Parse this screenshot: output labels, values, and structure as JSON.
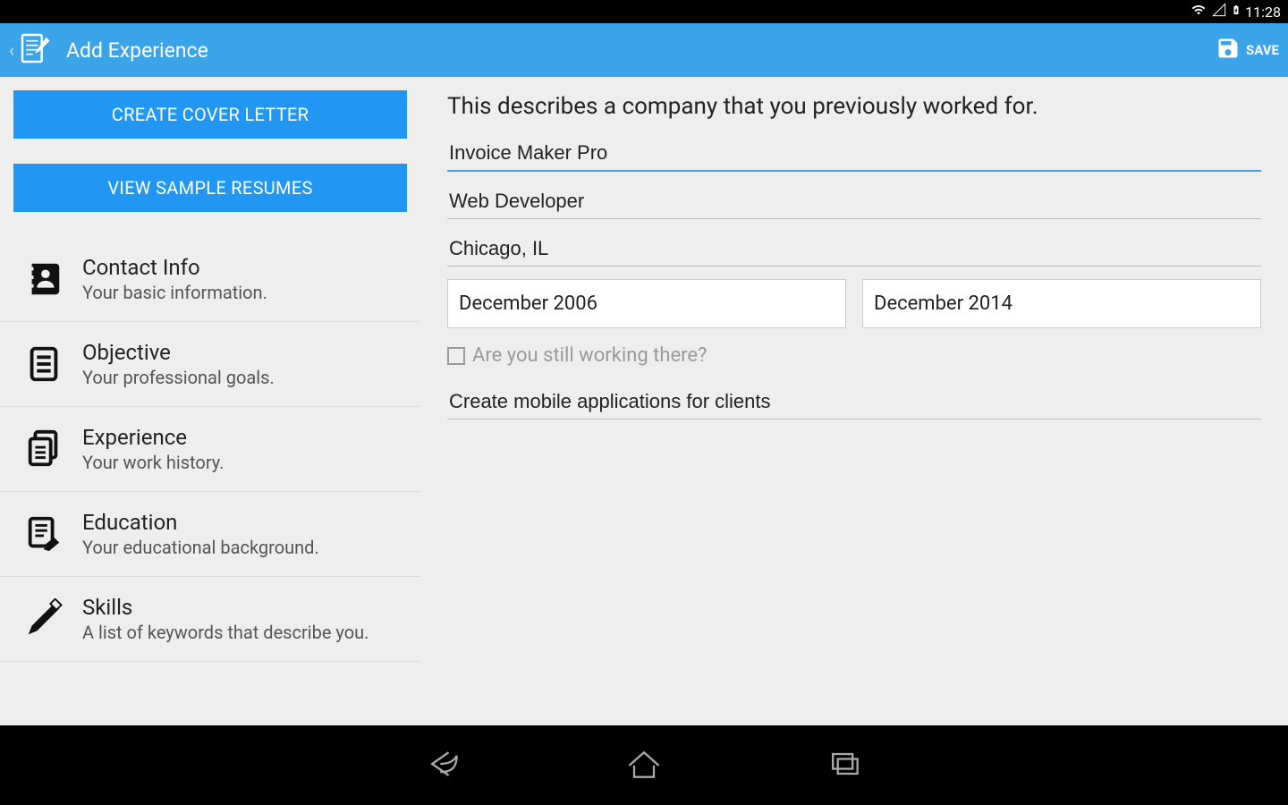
{
  "status": {
    "time": "11:28"
  },
  "actionbar": {
    "title": "Add Experience",
    "save": "SAVE"
  },
  "sidebar": {
    "btn_cover": "CREATE COVER LETTER",
    "btn_samples": "VIEW SAMPLE RESUMES",
    "items": [
      {
        "title": "Contact Info",
        "subtitle": "Your basic information."
      },
      {
        "title": "Objective",
        "subtitle": "Your professional goals."
      },
      {
        "title": "Experience",
        "subtitle": "Your work history."
      },
      {
        "title": "Education",
        "subtitle": "Your educational background."
      },
      {
        "title": "Skills",
        "subtitle": "A list of keywords that describe you."
      }
    ]
  },
  "form": {
    "heading": "This describes a company that you previously worked for.",
    "company": "Invoice Maker Pro",
    "position": "Web Developer",
    "location": "Chicago, IL",
    "start_date": "December 2006",
    "end_date": "December 2014",
    "still_working_label": "Are you still working there?",
    "description": "Create mobile applications for clients"
  }
}
